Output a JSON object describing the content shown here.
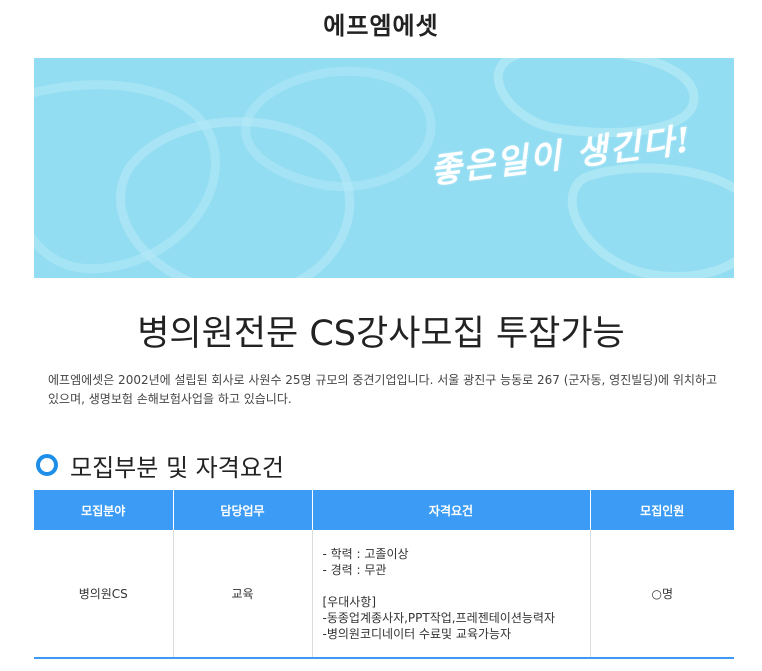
{
  "company_name": "에프엠에셋",
  "banner": {
    "slogan": "좋은일이 생긴다!",
    "background_color": "#93ddf2"
  },
  "headline": "병의원전문 CS강사모집 투잡가능",
  "intro": "에프엠에셋은 2002년에 설립된 회사로 사원수 25명 규모의 중견기업입니다. 서울 광진구 능동로 267 (군자동, 영진빌딩)에 위치하고 있으며, 생명보험 손해보험사업을 하고 있습니다.",
  "section": {
    "title": "모집부분 및 자격요건",
    "icon": "ring-icon"
  },
  "table": {
    "headers": [
      "모집분야",
      "담당업무",
      "자격요건",
      "모집인원"
    ],
    "row": {
      "field": "병의원CS",
      "duty": "교육",
      "requirements": {
        "education": "- 학력 : 고졸이상",
        "career": "- 경력 : 무관",
        "preferred_title": "[우대사항]",
        "preferred_1": "-동종업계종사자,PPT작업,프레젠테이션능력자",
        "preferred_2": "-병의원코디네이터 수료및 교육가능자"
      },
      "count": "○명"
    }
  },
  "colors": {
    "accent": "#3c9cf5",
    "ring": "#1e8fe8"
  }
}
